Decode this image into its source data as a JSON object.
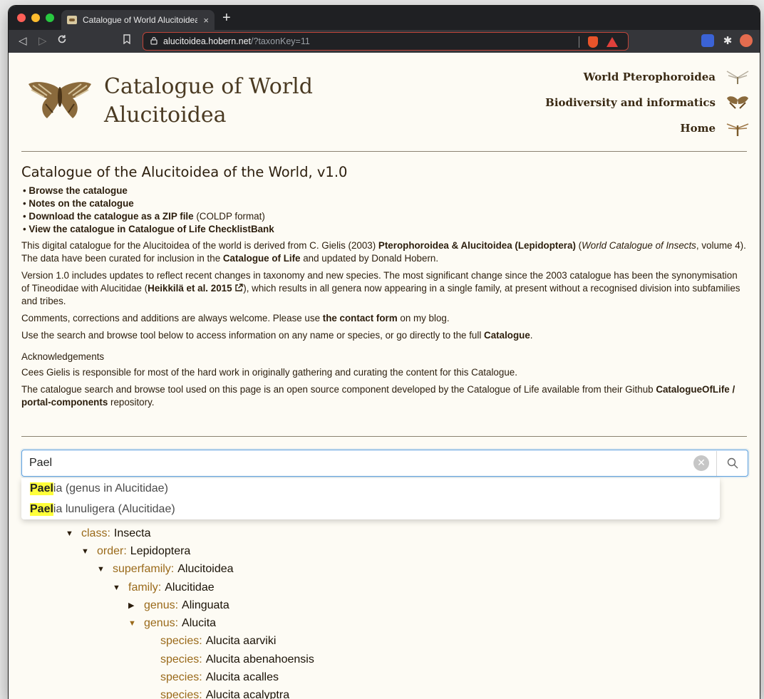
{
  "browser": {
    "tab_title": "Catalogue of World Alucitoidea",
    "tab_close": "×",
    "new_tab": "+",
    "url_host": "alucitoidea.hobern.net",
    "url_path": "/?taxonKey=11"
  },
  "site": {
    "title": "Catalogue of World Alucitoidea",
    "nav": [
      {
        "label": "World Pterophoroidea"
      },
      {
        "label": "Biodiversity and informatics"
      },
      {
        "label": "Home"
      }
    ]
  },
  "main": {
    "heading": "Catalogue of the Alucitoidea of the World, v1.0",
    "links": [
      "Browse the catalogue",
      "Notes on the catalogue",
      "Download the catalogue as a ZIP file",
      "View the catalogue in Catalogue of Life ChecklistBank"
    ],
    "download_suffix": " (COLDP format)",
    "p1": {
      "a": "This digital catalogue for the Alucitoidea of the world is derived from C. Gielis (2003) ",
      "b": "Pterophoroidea & Alucitoidea (Lepidoptera)",
      "c": " (",
      "d": "World Catalogue of Insects",
      "e": ", volume 4). The data have been curated for inclusion in the ",
      "f": "Catalogue of Life",
      "g": " and updated by Donald Hobern."
    },
    "p2": {
      "a": "Version 1.0 includes updates to reflect recent changes in taxonomy and new species. The most significant change since the 2003 catalogue has been the synonymisation of Tineodidae with Alucitidae (",
      "b": "Heikkilä et al. 2015",
      "c": "), which results in all genera now appearing in a single family, at present without a recognised division into subfamilies and tribes."
    },
    "p3": {
      "a": "Comments, corrections and additions are always welcome. Please use ",
      "b": "the contact form",
      "c": " on my blog."
    },
    "p4": {
      "a": "Use the search and browse tool below to access information on any name or species, or go directly to the full ",
      "b": "Catalogue",
      "c": "."
    },
    "ack_title": "Acknowledgements",
    "ack1": "Cees Gielis is responsible for most of the hard work in originally gathering and curating the content for this Catalogue.",
    "ack2": {
      "a": "The catalogue search and browse tool used on this page is an open source component developed by the Catalogue of Life available from their Github ",
      "b": "CatalogueOfLife / portal-components",
      "c": " repository."
    }
  },
  "search": {
    "value": "Pael",
    "suggestions": [
      {
        "match": "Pael",
        "rest": "ia (genus in Alucitidae)"
      },
      {
        "match": "Pael",
        "rest": "ia lunuligera (Alucitidae)"
      }
    ]
  },
  "tree": [
    {
      "rank": "class:",
      "name": "Insecta",
      "state": "open"
    },
    {
      "rank": "order:",
      "name": "Lepidoptera",
      "state": "open"
    },
    {
      "rank": "superfamily:",
      "name": "Alucitoidea",
      "state": "open"
    },
    {
      "rank": "family:",
      "name": "Alucitidae",
      "state": "open"
    },
    {
      "rank": "genus:",
      "name": "Alinguata",
      "state": "closed"
    },
    {
      "rank": "genus:",
      "name": "Alucita",
      "state": "open-gold"
    },
    {
      "rank": "species:",
      "name": "Alucita aarviki",
      "state": "leaf"
    },
    {
      "rank": "species:",
      "name": "Alucita abenahoensis",
      "state": "leaf"
    },
    {
      "rank": "species:",
      "name": "Alucita acalles",
      "state": "leaf"
    },
    {
      "rank": "species:",
      "name": "Alucita acalyptra",
      "state": "leaf"
    }
  ],
  "colors": {
    "rank": "#9a6a1a",
    "highlight": "#ffff3a",
    "search_border": "#5b9fde",
    "omnibox_border": "#c0453a"
  }
}
